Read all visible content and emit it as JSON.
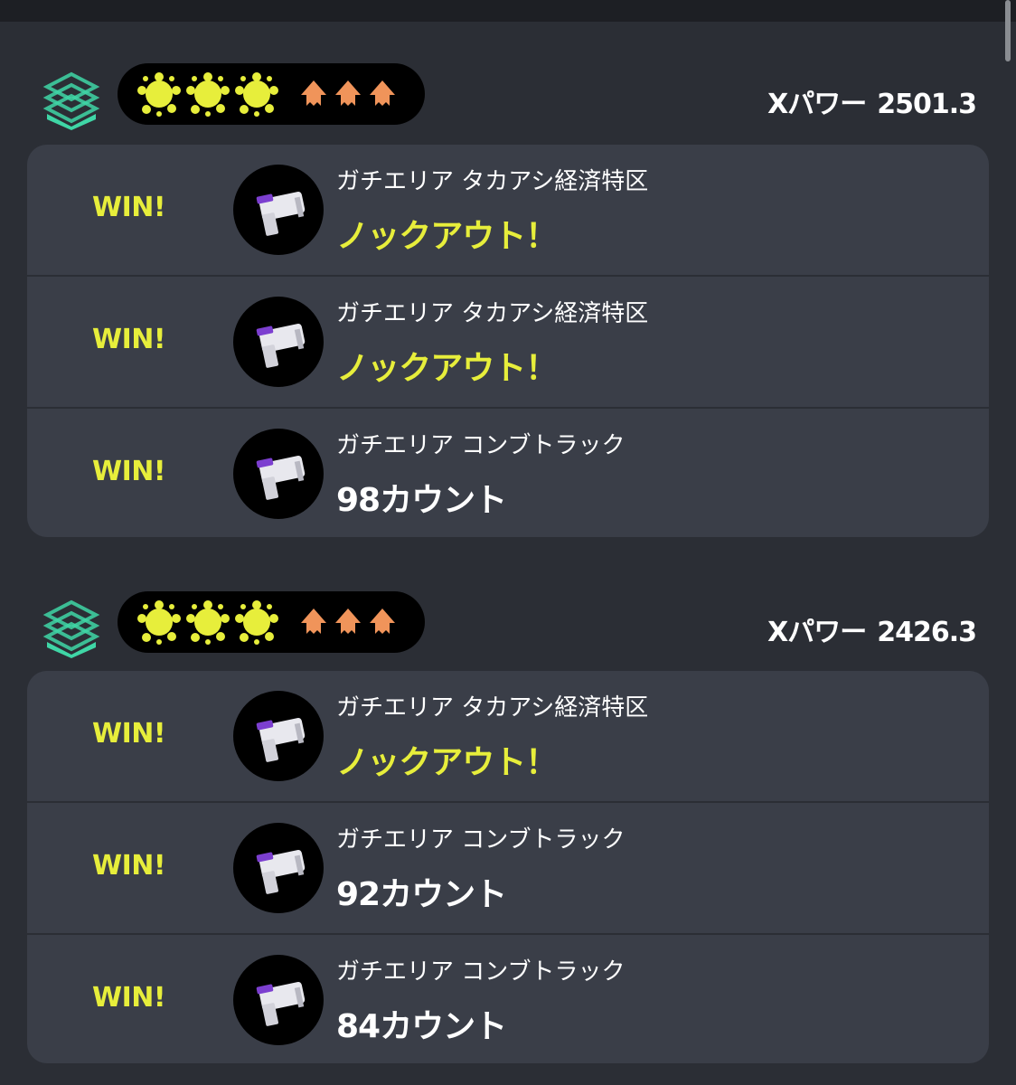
{
  "groups": [
    {
      "x_power_label": "Xパワー",
      "x_power_value": "2501.3",
      "wins": 3,
      "matches": [
        {
          "result": "WIN!",
          "stage": "ガチエリア タカアシ経済特区",
          "outcome": "ノックアウト！",
          "outcome_type": "knockout"
        },
        {
          "result": "WIN!",
          "stage": "ガチエリア タカアシ経済特区",
          "outcome": "ノックアウト！",
          "outcome_type": "knockout"
        },
        {
          "result": "WIN!",
          "stage": "ガチエリア コンブトラック",
          "outcome": "98カウント",
          "outcome_type": "count"
        }
      ]
    },
    {
      "x_power_label": "Xパワー",
      "x_power_value": "2426.3",
      "wins": 3,
      "matches": [
        {
          "result": "WIN!",
          "stage": "ガチエリア タカアシ経済特区",
          "outcome": "ノックアウト！",
          "outcome_type": "knockout"
        },
        {
          "result": "WIN!",
          "stage": "ガチエリア コンブトラック",
          "outcome": "92カウント",
          "outcome_type": "count"
        },
        {
          "result": "WIN!",
          "stage": "ガチエリア コンブトラック",
          "outcome": "84カウント",
          "outcome_type": "count"
        }
      ]
    }
  ],
  "icons": {
    "mode": "splat-zones-icon",
    "win_marker": "ink-splat-icon",
    "player": "squid-icon",
    "weapon": "blaster-weapon-icon"
  },
  "colors": {
    "background": "#2b2e35",
    "card": "#3a3e48",
    "win_yellow": "#e7ee3b",
    "squid_orange": "#f0945a",
    "mode_teal": "#3fd6a6"
  }
}
